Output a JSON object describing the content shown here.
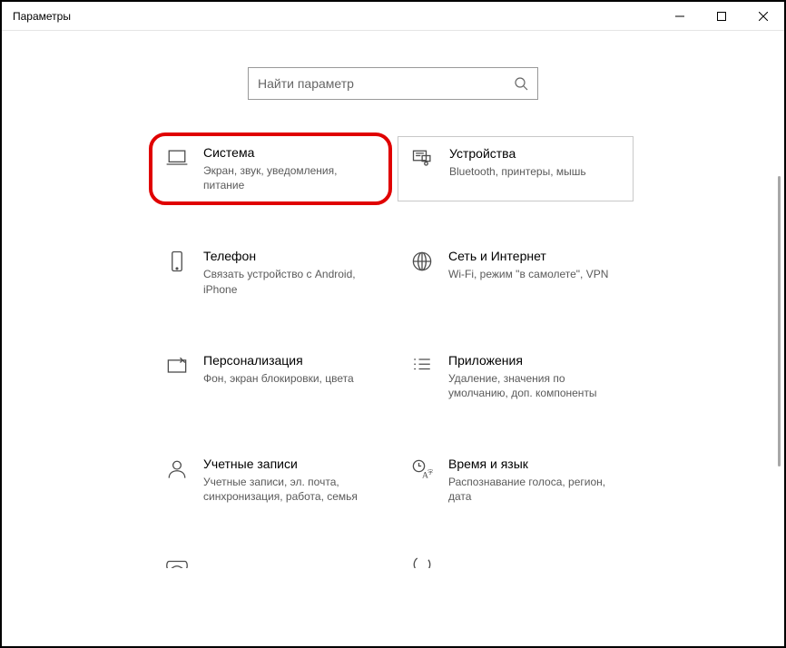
{
  "window": {
    "title": "Параметры"
  },
  "search": {
    "placeholder": "Найти параметр"
  },
  "tiles": {
    "system": {
      "title": "Система",
      "desc": "Экран, звук, уведомления, питание"
    },
    "devices": {
      "title": "Устройства",
      "desc": "Bluetooth, принтеры, мышь"
    },
    "phone": {
      "title": "Телефон",
      "desc": "Связать устройство с Android, iPhone"
    },
    "network": {
      "title": "Сеть и Интернет",
      "desc": "Wi-Fi, режим \"в самолете\", VPN"
    },
    "personalize": {
      "title": "Персонализация",
      "desc": "Фон, экран блокировки, цвета"
    },
    "apps": {
      "title": "Приложения",
      "desc": "Удаление, значения по умолчанию, доп. компоненты"
    },
    "accounts": {
      "title": "Учетные записи",
      "desc": "Учетные записи, эл. почта, синхронизация, работа, семья"
    },
    "time": {
      "title": "Время и язык",
      "desc": "Распознавание голоса, регион, дата"
    }
  }
}
